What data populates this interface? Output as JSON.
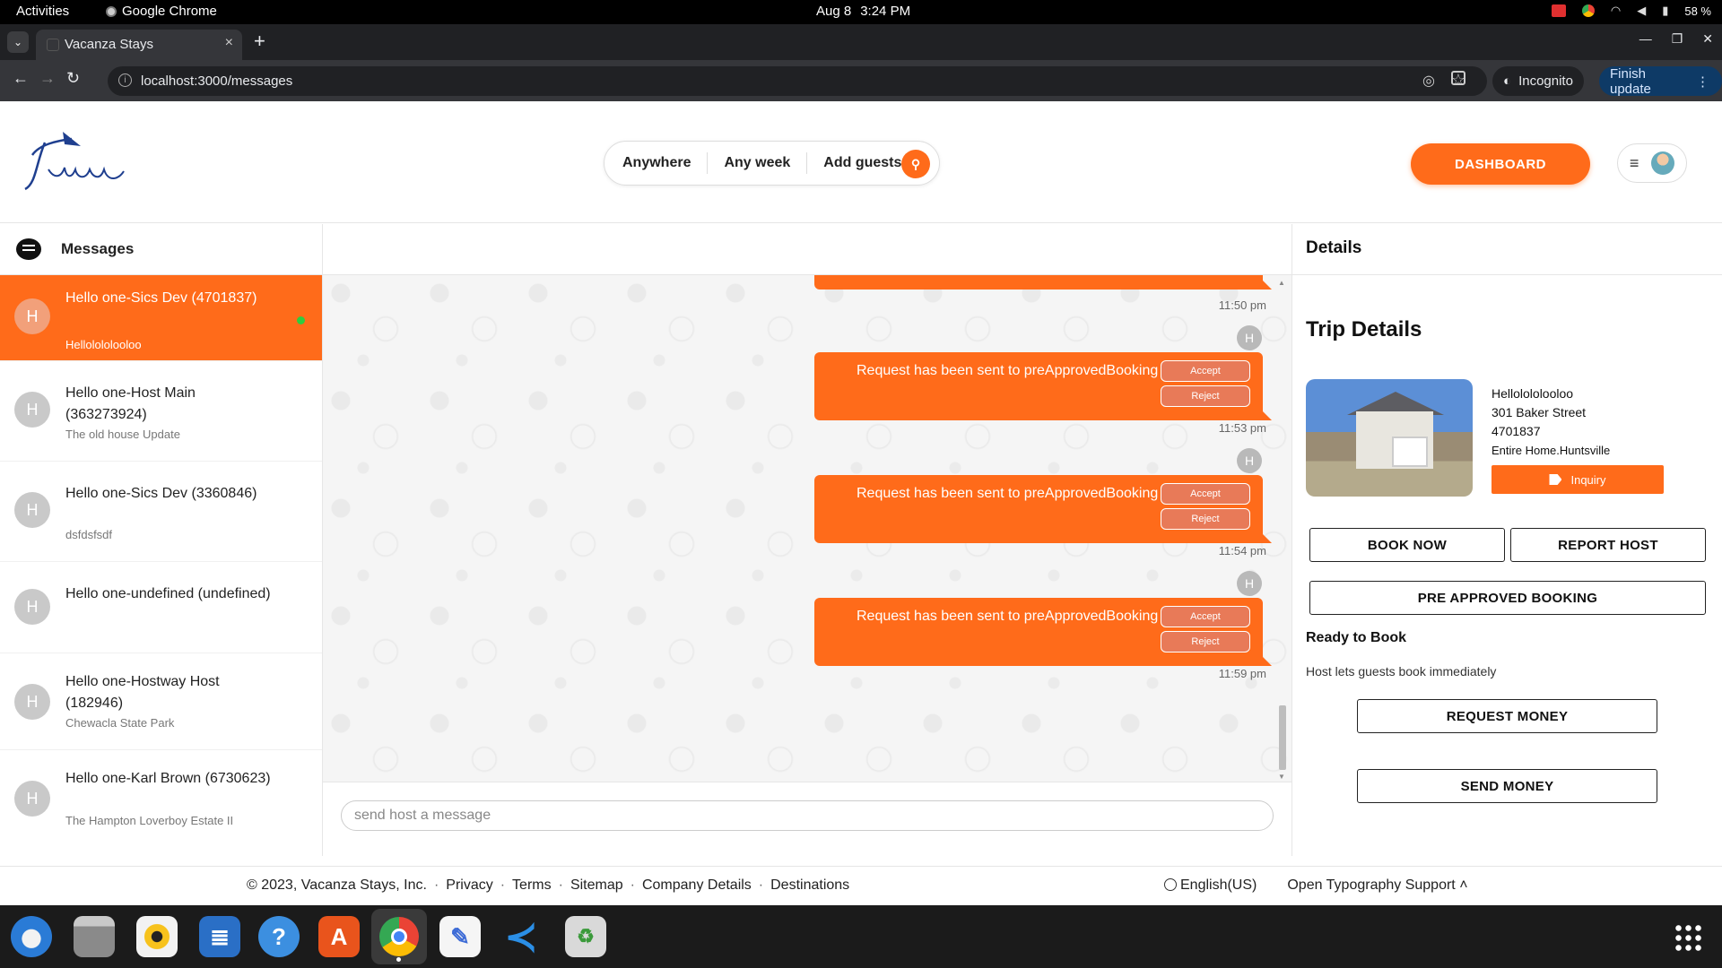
{
  "os": {
    "activities": "Activities",
    "app_name": "Google Chrome",
    "date": "Aug 8",
    "time": "3:24 PM",
    "battery": "58 %"
  },
  "browser": {
    "tab_title": "Vacanza Stays",
    "url": "localhost:3000/messages",
    "incognito_label": "Incognito",
    "finish_update_label": "Finish update"
  },
  "header": {
    "search": {
      "anywhere": "Anywhere",
      "any_week": "Any week",
      "add_guests": "Add guests"
    },
    "dashboard_label": "DASHBOARD",
    "brand_color": "#ff6b1a"
  },
  "conversations": {
    "title": "Messages",
    "items": [
      {
        "name": "Hello one-Sics Dev (4701837)",
        "preview": "Hellolololooloo",
        "active": true,
        "online": true,
        "initial": "H"
      },
      {
        "name": "Hello one-Host Main (363273924)",
        "preview": "The old house Update",
        "active": false,
        "initial": "H"
      },
      {
        "name": "Hello one-Sics Dev (3360846)",
        "preview": "dsfdsfsdf",
        "active": false,
        "initial": "H"
      },
      {
        "name": "Hello one-undefined (undefined)",
        "preview": "",
        "active": false,
        "initial": "H"
      },
      {
        "name": "Hello one-Hostway Host (182946)",
        "preview": "Chewacla State Park",
        "active": false,
        "initial": "H"
      },
      {
        "name": "Hello one-Karl Brown (6730623)",
        "preview": "The Hampton Loverboy Estate II",
        "active": false,
        "initial": "H"
      }
    ]
  },
  "chat": {
    "first_time": "11:50 pm",
    "messages": [
      {
        "text": "Request has been sent to preApprovedBooking",
        "accept": "Accept",
        "reject": "Reject",
        "time": "11:53 pm",
        "avatar": "H"
      },
      {
        "text": "Request has been sent to preApprovedBooking",
        "accept": "Accept",
        "reject": "Reject",
        "time": "11:54 pm",
        "avatar": "H"
      },
      {
        "text": "Request has been sent to preApprovedBooking",
        "accept": "Accept",
        "reject": "Reject",
        "time": "11:59 pm",
        "avatar": "H"
      }
    ],
    "input_placeholder": "send host a message"
  },
  "details": {
    "title": "Details",
    "trip_title": "Trip Details",
    "property": {
      "name": "Hellolololooloo",
      "street": "301 Baker Street",
      "id": "4701837",
      "type": "Entire Home.Huntsville"
    },
    "inquiry_label": "Inquiry",
    "book_now": "BOOK NOW",
    "report_host": "REPORT HOST",
    "pre_approved": "PRE APPROVED BOOKING",
    "ready_title": "Ready to Book",
    "ready_sub": "Host lets guests book immediately",
    "request_money": "REQUEST MONEY",
    "send_money": "SEND MONEY"
  },
  "footer": {
    "copyright": "© 2023, Vacanza Stays, Inc.",
    "links": [
      "Privacy",
      "Terms",
      "Sitemap",
      "Company Details",
      "Destinations"
    ],
    "language": "English(US)",
    "typography": "Open Typography Support"
  },
  "dock": {
    "apps": [
      "thunderbird-icon",
      "files-icon",
      "rhythmbox-icon",
      "writer-icon",
      "help-icon",
      "app-center-icon",
      "chrome-icon",
      "text-editor-icon",
      "vscode-icon",
      "trash-icon"
    ]
  }
}
